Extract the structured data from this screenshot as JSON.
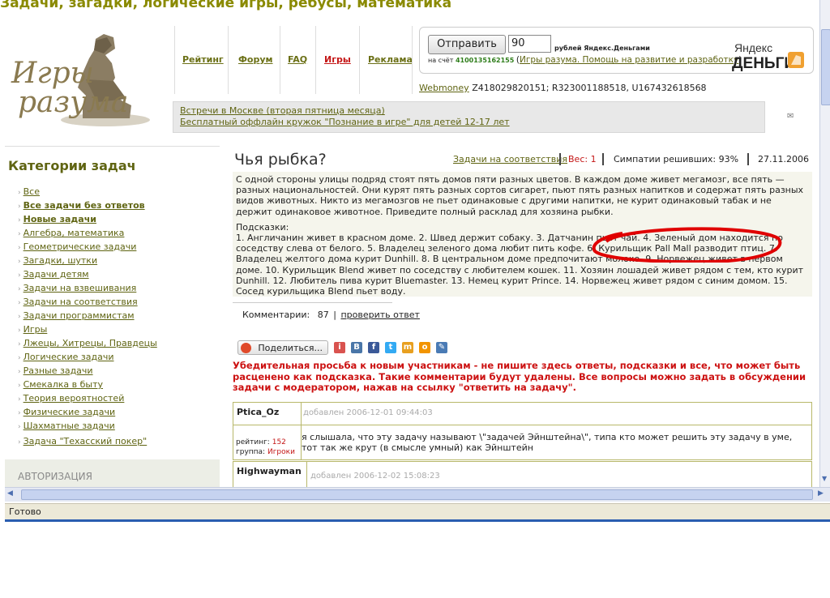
{
  "site": {
    "title": "Задачи, загадки, логические игры, ребусы, математика",
    "logo_line1": "Игры",
    "logo_line2": "разума"
  },
  "nav": [
    {
      "label": "Рейтинг",
      "active": false
    },
    {
      "label": "Форум",
      "active": false
    },
    {
      "label": "FAQ",
      "active": false
    },
    {
      "label": "Игры",
      "active": true
    },
    {
      "label": "Реклама",
      "active": false
    }
  ],
  "donate": {
    "send_button": "Отправить",
    "amount": "90",
    "currency_label": "рублей Яндекс.Деньгами",
    "account_prefix": "на счёт",
    "account_number": "4100135162155",
    "purpose_link": "Игры разума. Помощь на развитие и разработку",
    "yandex_line1": "Яндекс",
    "yandex_line2": "ДЕНЬГИ",
    "webmoney_label": "Webmoney",
    "webmoney_wallets": "Z418029820151; R323001188518, U167432618568"
  },
  "banner": {
    "line1": "Встречи в Москве (вторая пятница месяца)",
    "line2": "Бесплатный оффлайн кружок \"Познание в игре\" для детей 12-17 лет"
  },
  "sidebar": {
    "header": "Категории задач",
    "items": [
      {
        "label": "Все",
        "bold": false
      },
      {
        "label": "Все задачи без ответов",
        "bold": true
      },
      {
        "label": "Новые задачи",
        "bold": true
      },
      {
        "label": "Алгебра, математика",
        "bold": false
      },
      {
        "label": "Геометрические задачи",
        "bold": false
      },
      {
        "label": "Загадки, шутки",
        "bold": false
      },
      {
        "label": "Задачи детям",
        "bold": false
      },
      {
        "label": "Задачи на взвешивания",
        "bold": false
      },
      {
        "label": "Задачи на соответствия",
        "bold": false
      },
      {
        "label": "Задачи программистам",
        "bold": false
      },
      {
        "label": "Игры",
        "bold": false
      },
      {
        "label": "Лжецы, Хитрецы, Правдецы",
        "bold": false
      },
      {
        "label": "Логические задачи",
        "bold": false
      },
      {
        "label": "Разные задачи",
        "bold": false
      },
      {
        "label": "Смекалка в быту",
        "bold": false
      },
      {
        "label": "Теория вероятностей",
        "bold": false
      },
      {
        "label": "Физические задачи",
        "bold": false
      },
      {
        "label": "Шахматные задачи",
        "bold": false
      },
      {
        "label": "Задача \"Техасский покер\"",
        "bold": false
      }
    ],
    "auth_header": "АВТОРИЗАЦИЯ"
  },
  "puzzle": {
    "title": "Чья рыбка?",
    "category_link": "Задачи на соответствия",
    "weight": "Вес: 1",
    "sympathy": "Симпатии решивших: 93%",
    "date": "27.11.2006",
    "text": "С одной стороны улицы подряд стоят пять домов пяти разных цветов. В каждом доме живет мегамозг, все пять — разных национальностей. Они курят пять разных сортов сигарет, пьют пять разных напитков и содержат пять разных видов животных. Никто из мегамозгов не пьет одинаковые с другими напитки, не курит одинаковый табак и не держит одинаковое животное. Приведите полный расклад для хозяина рыбки.",
    "hints_label": "Подсказки:",
    "hints": "1. Англичанин живет в красном доме. 2. Швед держит собаку. 3. Датчанин пьет чай. 4. Зеленый дом находится по соседству слева от белого. 5. Владелец зеленого дома любит пить кофе. 6. Курильщик Pall Mall разводит птиц. 7. Владелец желтого дома курит Dunhill. 8. В центральном доме предпочитают молоко. 9. Норвежец живет в первом доме. 10. Курильщик Blend живет по соседству с любителем кошек. 11. Хозяин лошадей живет рядом с тем, кто курит Dunhill. 12. Любитель пива курит Bluemaster. 13. Немец курит Prince. 14. Норвежец живет рядом с синим домом. 15. Сосед курильщика Blend пьет воду.",
    "comments_label": "Комментарии:",
    "comments_count": "87",
    "check_answer": "проверить ответ"
  },
  "share": {
    "button": "Поделиться...",
    "icons": [
      "i",
      "В",
      "f",
      "t",
      "m",
      "o",
      "✎"
    ]
  },
  "warning": "Убедительная просьба к новым участникам - не пишите здесь ответы, подсказки и все, что может быть расценено как подсказка. Такие комментарии будут удалены. Все вопросы можно задать в обсуждении задачи с модератором, нажав на ссылку \"ответить на задачу\".",
  "comments": [
    {
      "author": "Ptica_Oz",
      "date": "добавлен 2006-12-01 09:44:03",
      "rating_label": "рейтинг:",
      "rating": "152",
      "group_label": "группа:",
      "group": "Игроки",
      "text": "я слышала, что эту задачу называют \\\"задачей Эйнштейна\\\", типа кто может решить эту задачу в уме, тот так же крут (в смысле умный) как Эйнштейн"
    },
    {
      "author": "Highwayman",
      "date": "добавлен 2006-12-02 15:08:23"
    }
  ],
  "browser": {
    "status": "Готово"
  },
  "colors": {
    "accent": "#5f6412",
    "warning": "#cc1111",
    "active_nav": "#c41616",
    "annotation": "#e00000"
  }
}
